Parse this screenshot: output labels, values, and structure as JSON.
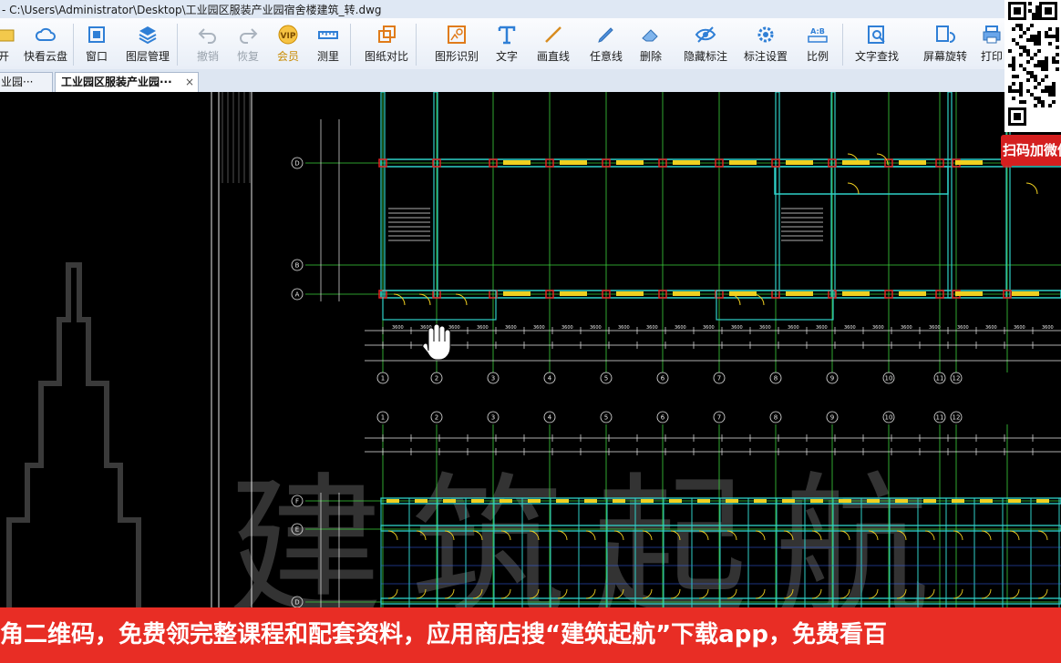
{
  "window": {
    "title": "- C:\\Users\\Administrator\\Desktop\\工业园区服装产业园宿舍楼建筑_转.dwg"
  },
  "toolbar": {
    "items": [
      {
        "label": "开",
        "icon": "open-icon",
        "disabled": false
      },
      {
        "label": "快看云盘",
        "icon": "cloud-icon",
        "disabled": false
      },
      {
        "label": "窗口",
        "icon": "window-icon",
        "disabled": false
      },
      {
        "label": "图层管理",
        "icon": "layers-icon",
        "disabled": false
      },
      {
        "label": "撤销",
        "icon": "undo-icon",
        "disabled": true
      },
      {
        "label": "恢复",
        "icon": "redo-icon",
        "disabled": true
      },
      {
        "label": "会员",
        "icon": "vip-icon",
        "disabled": false
      },
      {
        "label": "测里",
        "icon": "measure-icon",
        "disabled": false
      },
      {
        "label": "图纸对比",
        "icon": "compare-icon",
        "disabled": false
      },
      {
        "label": "图形识别",
        "icon": "shape-recognize-icon",
        "disabled": false
      },
      {
        "label": "文字",
        "icon": "text-icon",
        "disabled": false
      },
      {
        "label": "画直线",
        "icon": "line-icon",
        "disabled": false
      },
      {
        "label": "任意线",
        "icon": "pen-icon",
        "disabled": false
      },
      {
        "label": "删除",
        "icon": "eraser-icon",
        "disabled": false
      },
      {
        "label": "隐藏标注",
        "icon": "eye-hide-icon",
        "disabled": false
      },
      {
        "label": "标注设置",
        "icon": "settings-icon",
        "disabled": false
      },
      {
        "label": "比例",
        "icon": "scale-icon",
        "disabled": false
      },
      {
        "label": "文字查找",
        "icon": "text-search-icon",
        "disabled": false
      },
      {
        "label": "屏幕旋转",
        "icon": "rotate-icon",
        "disabled": false
      },
      {
        "label": "打印",
        "icon": "print-icon",
        "disabled": false
      }
    ]
  },
  "tabs": [
    {
      "label": "业园···",
      "close": "×",
      "active": false
    },
    {
      "label": "工业园区服装产业园···",
      "close": "×",
      "active": true
    }
  ],
  "drawing": {
    "axis_bubbles_top": [
      "1",
      "2",
      "3",
      "4",
      "5",
      "6",
      "7",
      "8",
      "9",
      "10",
      "11",
      "12"
    ],
    "axis_bubbles_bottom": [
      "1",
      "2",
      "3",
      "4",
      "5",
      "6",
      "7",
      "8",
      "9",
      "10",
      "11",
      "12"
    ],
    "row_bubbles_top": [
      "D",
      "B",
      "A"
    ],
    "row_bubbles_bottom": [
      "F",
      "E",
      "D"
    ],
    "watermark": "建筑起航"
  },
  "overlay": {
    "banner_text": "角二维码，免费领完整课程和配套资料，应用商店搜“建筑起航”下载app，免费看百",
    "side_tag": "扫码加微信",
    "colors": {
      "banner": "#e82d25",
      "cad_bg": "#000000",
      "grid_line": "#2fd0c8",
      "axis_green": "#3bd13b",
      "dim_white": "#ffffff"
    }
  }
}
